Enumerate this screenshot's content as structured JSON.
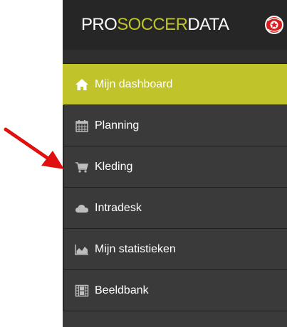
{
  "header": {
    "brand_part1": "PRO",
    "brand_part2": "SOCCER",
    "brand_part3": "DATA",
    "logo_icon": "club-badge-icon"
  },
  "nav": {
    "items": [
      {
        "label": "Mijn dashboard",
        "icon": "home-icon",
        "active": true
      },
      {
        "label": "Planning",
        "icon": "calendar-icon",
        "active": false
      },
      {
        "label": "Kleding",
        "icon": "shopping-cart-icon",
        "active": false
      },
      {
        "label": "Intradesk",
        "icon": "cloud-icon",
        "active": false
      },
      {
        "label": "Mijn statistieken",
        "icon": "area-chart-icon",
        "active": false
      },
      {
        "label": "Beeldbank",
        "icon": "film-icon",
        "active": false
      }
    ]
  },
  "annotation": {
    "icon": "red-arrow-icon"
  },
  "colors": {
    "accent": "#c0c42a",
    "header_bg": "#262626",
    "nav_bg": "#3a3a3a",
    "arrow": "#e01010"
  }
}
